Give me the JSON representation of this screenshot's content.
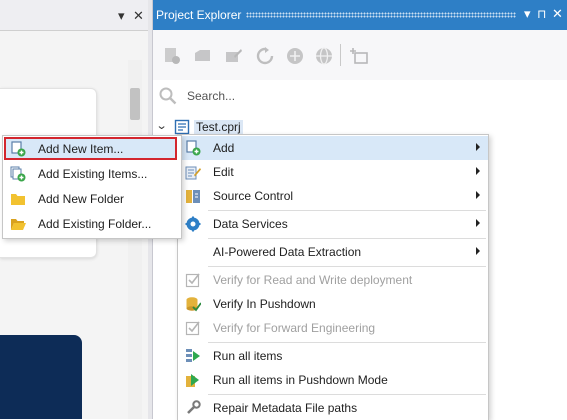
{
  "left_pane": {
    "pin_glyph": "▾",
    "close_glyph": "✕"
  },
  "explorer": {
    "title": "Project Explorer",
    "buttons": {
      "dropdown": "▾",
      "pin": "⊓",
      "close": "✕"
    },
    "toolbar_icons": [
      "new-item-icon",
      "open-icon",
      "edit-icon",
      "refresh-icon",
      "connect-icon",
      "globe-icon",
      "add-node-icon"
    ],
    "search": {
      "placeholder": "Search..."
    },
    "tree": {
      "expander": "⌄",
      "root_label": "Test.cprj",
      "root_icon": "project-file-icon"
    }
  },
  "context_menu": {
    "items": [
      {
        "label": "Add",
        "icon": "add-icon",
        "submenu": true,
        "highlighted": true,
        "disabled": false
      },
      {
        "label": "Edit",
        "icon": "edit-icon",
        "submenu": true,
        "disabled": false
      },
      {
        "label": "Source Control",
        "icon": "source-control-icon",
        "submenu": true,
        "disabled": false
      },
      {
        "label": "Data Services",
        "icon": "data-services-icon",
        "submenu": true,
        "disabled": false
      },
      {
        "label": "AI-Powered Data Extraction",
        "icon": "",
        "submenu": true,
        "disabled": false
      },
      {
        "label": "Verify for Read and Write deployment",
        "icon": "verify-icon",
        "submenu": false,
        "disabled": true
      },
      {
        "label": "Verify In Pushdown",
        "icon": "verify-pushdown-icon",
        "submenu": false,
        "disabled": false
      },
      {
        "label": "Verify for Forward Engineering",
        "icon": "verify-icon",
        "submenu": false,
        "disabled": true
      },
      {
        "label": "Run all items",
        "icon": "run-icon",
        "submenu": false,
        "disabled": false
      },
      {
        "label": "Run all items in Pushdown Mode",
        "icon": "run-pushdown-icon",
        "submenu": false,
        "disabled": false
      },
      {
        "label": "Repair Metadata File paths",
        "icon": "repair-icon",
        "submenu": false,
        "disabled": false
      }
    ]
  },
  "add_submenu": {
    "items": [
      {
        "label": "Add New Item...",
        "icon": "new-item-icon",
        "highlighted": true
      },
      {
        "label": "Add Existing Items...",
        "icon": "existing-items-icon",
        "highlighted": false
      },
      {
        "label": "Add New Folder",
        "icon": "new-folder-icon",
        "highlighted": false
      },
      {
        "label": "Add Existing Folder...",
        "icon": "existing-folder-icon",
        "highlighted": false
      }
    ]
  },
  "colors": {
    "titlebar": "#2e7fc6",
    "highlight": "#d8e8f8",
    "callout_border": "#d3262e",
    "dark_panel": "#0d2c57"
  }
}
